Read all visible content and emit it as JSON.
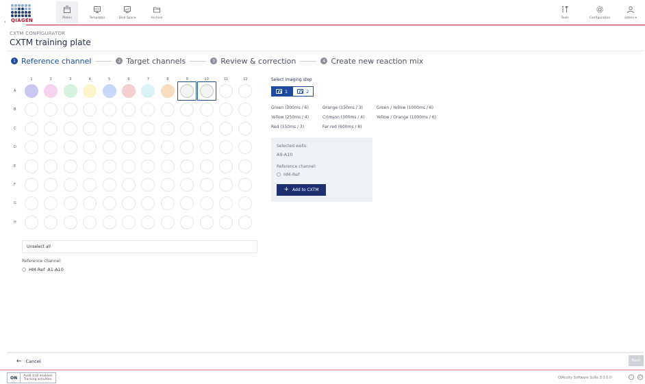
{
  "nav": {
    "logo_text": "QIAGEN",
    "items": [
      {
        "label": "Plates",
        "icon": "plate-icon",
        "active": true
      },
      {
        "label": "Templates",
        "icon": "template-icon",
        "active": false
      },
      {
        "label": "Disk Space",
        "icon": "disk-icon",
        "active": false
      },
      {
        "label": "Archive",
        "icon": "folder-icon",
        "active": false
      }
    ],
    "right_items": [
      {
        "label": "Tools",
        "icon": "tools-icon"
      },
      {
        "label": "Configuration",
        "icon": "gear-icon"
      },
      {
        "label": "admin ▾",
        "icon": "user-icon"
      }
    ]
  },
  "header": {
    "breadcrumb": "CXTM CONFIGURATOR",
    "title": "CXTM training plate"
  },
  "stepper": [
    {
      "num": "1",
      "label": "Reference channel",
      "active": true
    },
    {
      "num": "2",
      "label": "Target channels",
      "active": false
    },
    {
      "num": "3",
      "label": "Review & correction",
      "active": false
    },
    {
      "num": "4",
      "label": "Create new reaction mix",
      "active": false
    }
  ],
  "plate": {
    "columns": [
      "1",
      "2",
      "3",
      "4",
      "5",
      "6",
      "7",
      "8",
      "9",
      "10",
      "11",
      "12"
    ],
    "rows": [
      "A",
      "B",
      "C",
      "D",
      "E",
      "F",
      "G",
      "H"
    ],
    "row_a_colors": [
      "#c9c8f2",
      "#f6d3ee",
      "#d5f3de",
      "#fbf5c8",
      "#c8d6f7",
      "#f4cfd0",
      "#d9f2f8",
      "#f8dcc0"
    ],
    "selected_wells": [
      "A9",
      "A10"
    ],
    "unselect_all": "Unselect all",
    "reference_channel_label": "Reference channel:",
    "reference_channel_value": "HM-Ref",
    "reference_channel_range": "A1-A10"
  },
  "imaging": {
    "label": "Select imaging step",
    "steps": [
      "1",
      "2"
    ],
    "active_step": "1",
    "channels": [
      [
        "Green (300ms / 6)",
        "Orange (150ms / 3)",
        "Green / Yellow (1000ms / 6)"
      ],
      [
        "Yellow (250ms / 4)",
        "Crimson (300ms / 4)",
        "Yellow / Orange (1000ms / 6)"
      ],
      [
        "Red (150ms / 3)",
        "Far red (600ms / 8)",
        ""
      ]
    ]
  },
  "panel": {
    "selected_label": "Selected wells:",
    "selected_value": "A9-A10",
    "ref_label": "Reference channel:",
    "ref_value": "HM-Ref",
    "add_button": "Add to CXTM"
  },
  "footer": {
    "cancel": "Cancel",
    "next": "Next",
    "audit_on": "ON",
    "audit_line1": "Audit trail enabled.",
    "audit_line2": "Tracking activities.",
    "version": "QIAcuity Software Suite 3.0.0.0"
  }
}
